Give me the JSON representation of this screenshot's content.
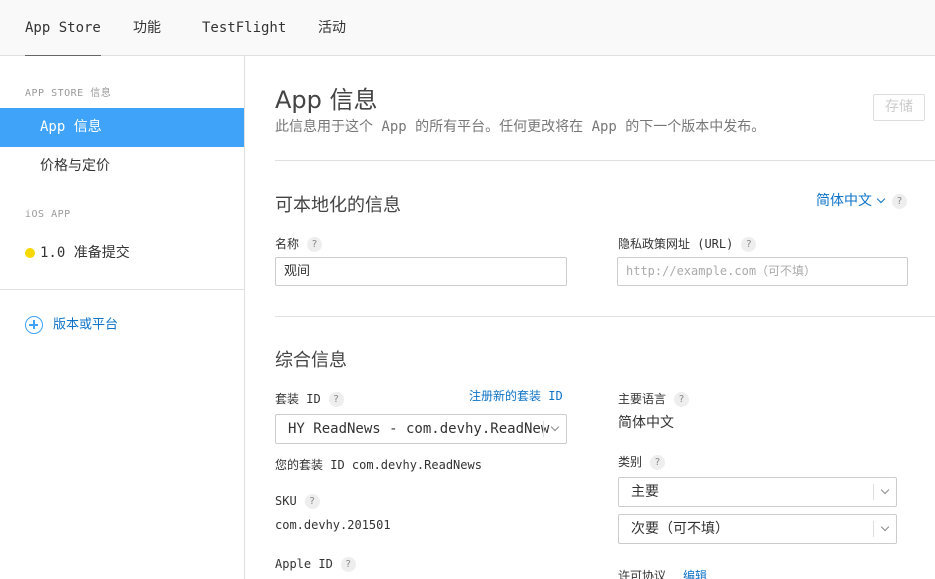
{
  "topnav": {
    "tabs": [
      {
        "label": "App Store",
        "active": true
      },
      {
        "label": "功能"
      },
      {
        "label": "TestFlight"
      },
      {
        "label": "活动"
      }
    ]
  },
  "sidebar": {
    "section_appstore": "APP STORE 信息",
    "items": [
      {
        "label": "App 信息",
        "selected": true
      },
      {
        "label": "价格与定价"
      }
    ],
    "section_ios": "iOS APP",
    "version": {
      "label": "1.0 准备提交",
      "status_color": "#f7d800"
    },
    "add_platform": "版本或平台"
  },
  "main": {
    "title": "App 信息",
    "subtitle": "此信息用于这个 App 的所有平台。任何更改将在 App 的下一个版本中发布。",
    "save_label": "存储",
    "localizable": {
      "title": "可本地化的信息",
      "language": "简体中文",
      "name_label": "名称",
      "name_value": "观间",
      "privacy_label": "隐私政策网址 (URL)",
      "privacy_placeholder": "http://example.com（可不填）"
    },
    "general": {
      "title": "综合信息",
      "bundle_label": "套装 ID",
      "register_bundle_link": "注册新的套装 ID",
      "bundle_value": "HY ReadNews - com.devhy.ReadNew",
      "bundle_hint": "您的套装 ID com.devhy.ReadNews",
      "sku_label": "SKU",
      "sku_value": "com.devhy.201501",
      "apple_id_label": "Apple ID",
      "primary_lang_label": "主要语言",
      "primary_lang_value": "简体中文",
      "category_label": "类别",
      "category_primary": "主要",
      "category_secondary": "次要（可不填）",
      "license_label": "许可协议",
      "license_edit": "编辑"
    },
    "help_mark": "?"
  },
  "colors": {
    "accent": "#3ea3f9",
    "link": "#0e73c7"
  }
}
